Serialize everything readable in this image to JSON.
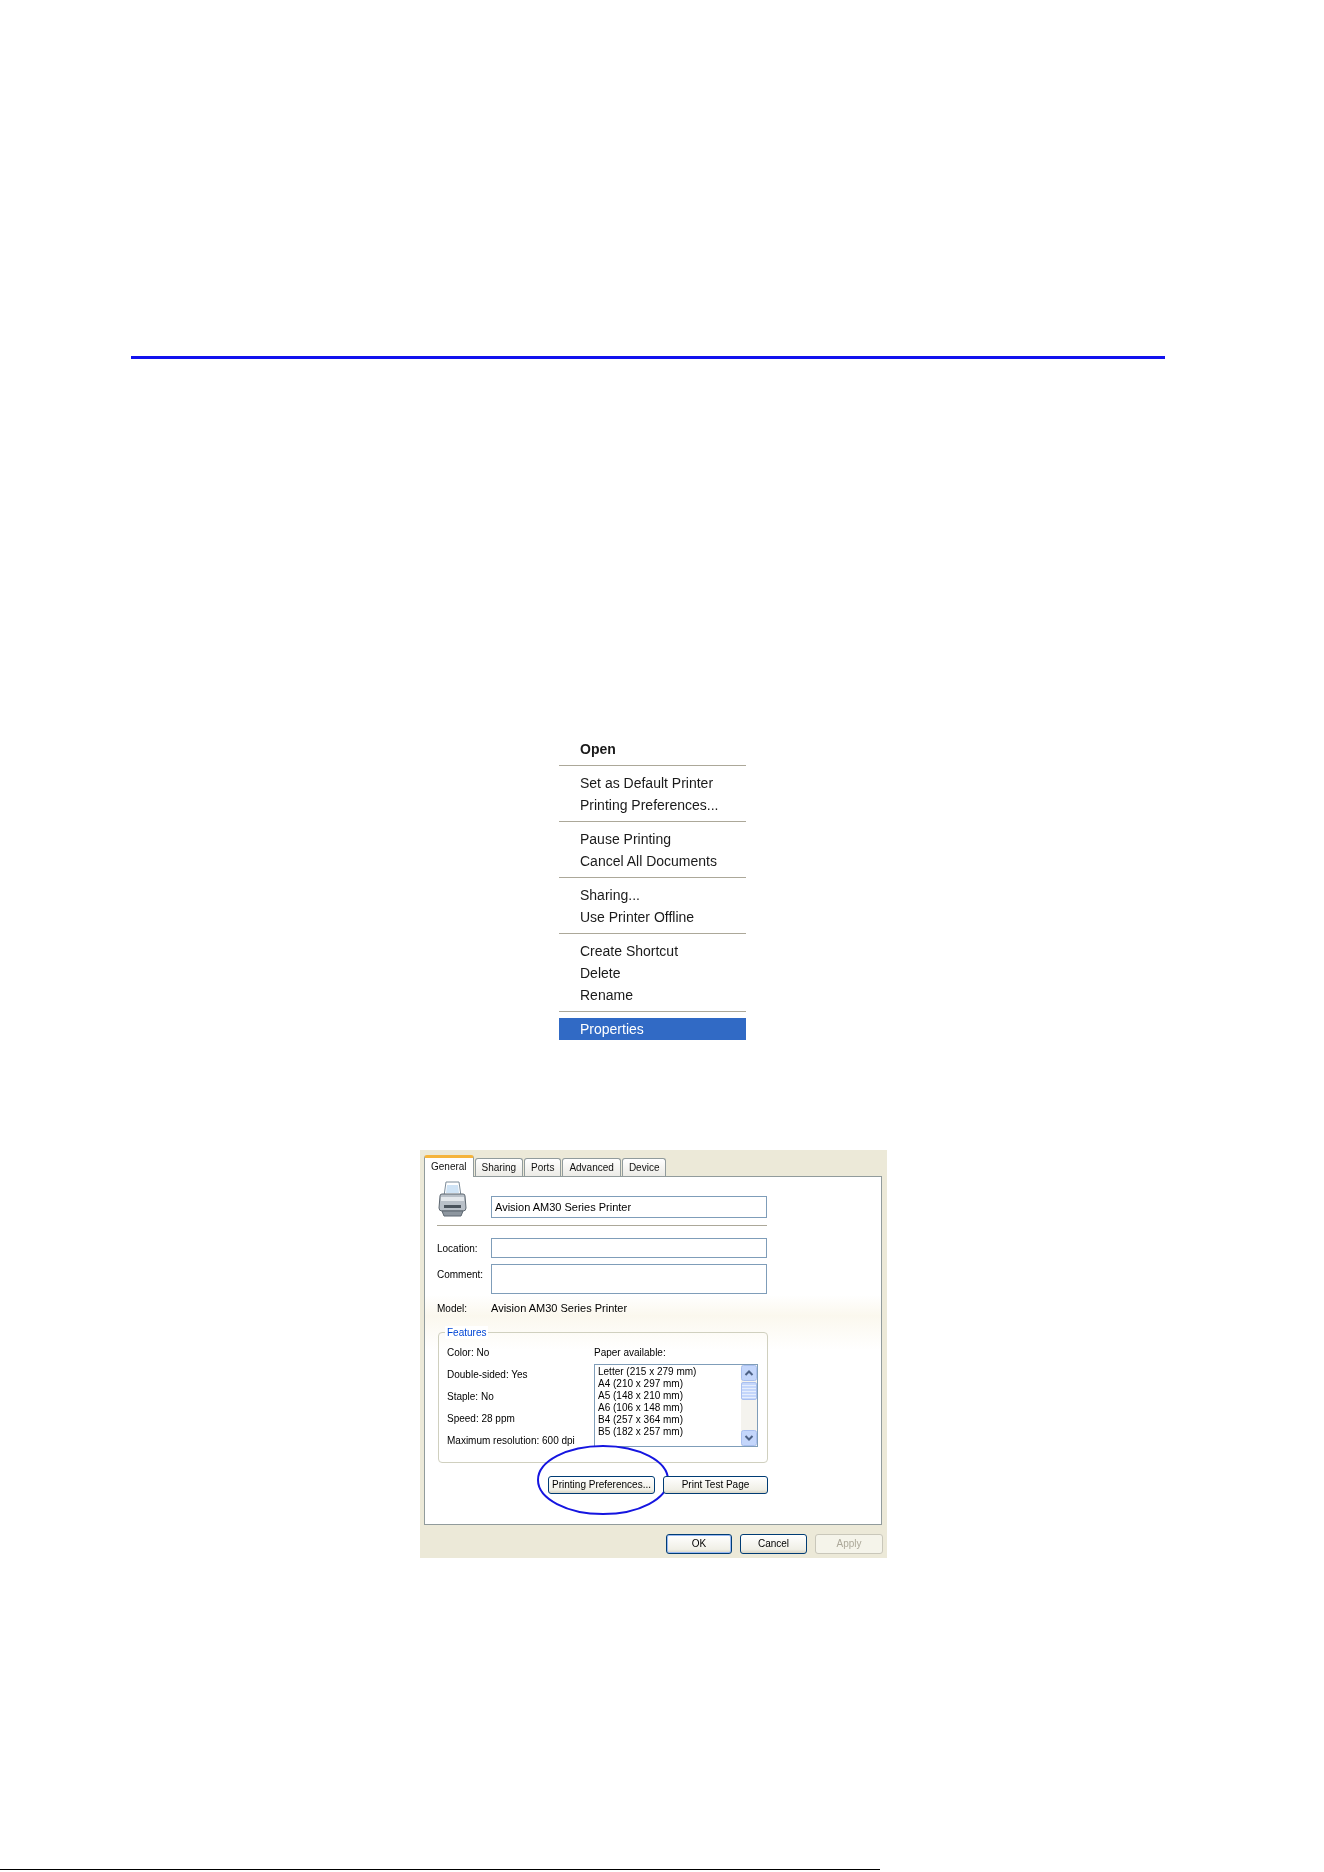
{
  "context_menu": {
    "groups": [
      {
        "items": [
          {
            "label": "Open",
            "default": true,
            "selected": false
          }
        ]
      },
      {
        "items": [
          {
            "label": "Set as Default Printer",
            "default": false,
            "selected": false
          },
          {
            "label": "Printing Preferences...",
            "default": false,
            "selected": false
          }
        ]
      },
      {
        "items": [
          {
            "label": "Pause Printing",
            "default": false,
            "selected": false
          },
          {
            "label": "Cancel All Documents",
            "default": false,
            "selected": false
          }
        ]
      },
      {
        "items": [
          {
            "label": "Sharing...",
            "default": false,
            "selected": false
          },
          {
            "label": "Use Printer Offline",
            "default": false,
            "selected": false
          }
        ]
      },
      {
        "items": [
          {
            "label": "Create Shortcut",
            "default": false,
            "selected": false
          },
          {
            "label": "Delete",
            "default": false,
            "selected": false
          },
          {
            "label": "Rename",
            "default": false,
            "selected": false
          }
        ]
      },
      {
        "items": [
          {
            "label": "Properties",
            "default": false,
            "selected": true
          }
        ]
      }
    ]
  },
  "properties_dialog": {
    "tabs": [
      {
        "label": "General",
        "selected": true
      },
      {
        "label": "Sharing",
        "selected": false
      },
      {
        "label": "Ports",
        "selected": false
      },
      {
        "label": "Advanced",
        "selected": false
      },
      {
        "label": "Device",
        "selected": false
      }
    ],
    "printer_name": {
      "value": "Avision AM30 Series Printer"
    },
    "location": {
      "label": "Location:"
    },
    "comment": {
      "label": "Comment:"
    },
    "model": {
      "label": "Model:",
      "value": "Avision AM30 Series Printer"
    },
    "features": {
      "title": "Features",
      "items": [
        "Color: No",
        "Double-sided: Yes",
        "Staple: No",
        "Speed: 28 ppm",
        "Maximum resolution: 600 dpi"
      ],
      "paper_label": "Paper available:",
      "paper_sizes": [
        "Letter (215 x 279 mm)",
        "A4 (210 x 297 mm)",
        "A5 (148 x 210 mm)",
        "A6 (106 x 148 mm)",
        "B4 (257 x 364 mm)",
        "B5 (182 x 257 mm)"
      ]
    },
    "panel_buttons": [
      {
        "label": "Printing Preferences...",
        "circled": true
      },
      {
        "label": "Print Test Page",
        "circled": false
      }
    ],
    "buttons": [
      {
        "label": "OK",
        "default": true,
        "disabled": false
      },
      {
        "label": "Cancel",
        "default": false,
        "disabled": false
      },
      {
        "label": "Apply",
        "default": false,
        "disabled": true
      }
    ]
  }
}
